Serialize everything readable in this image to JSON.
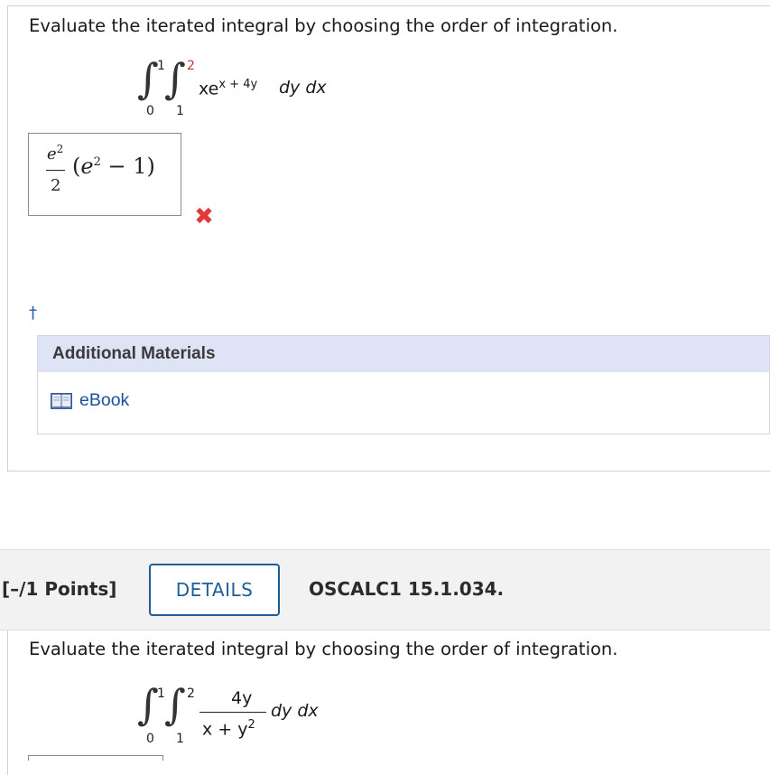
{
  "question1": {
    "prompt": "Evaluate the iterated integral by choosing the order of integration.",
    "outer_lower": "0",
    "outer_upper": "1",
    "inner_lower": "1",
    "inner_upper": "2",
    "integrand_base": "xe",
    "integrand_exponent": "x + 4y",
    "differentials": "dy dx",
    "answer": {
      "numerator_base": "e",
      "numerator_exponent": "2",
      "denominator": "2",
      "paren_base": "e",
      "paren_exponent": "2",
      "paren_rest": "− 1",
      "open_paren": "(",
      "close_paren": ")"
    },
    "status": "incorrect",
    "status_icon": "x-mark-icon",
    "status_symbol": "✖",
    "dagger": "†"
  },
  "additional_materials": {
    "title": "Additional Materials",
    "items": [
      {
        "label": "eBook",
        "icon": "book-icon"
      }
    ]
  },
  "question2": {
    "points": "[–/1 Points]",
    "details_label": "DETAILS",
    "problem_id": "OSCALC1 15.1.034.",
    "prompt": "Evaluate the iterated integral by choosing the order of integration.",
    "outer_lower": "0",
    "outer_upper": "1",
    "inner_lower": "1",
    "inner_upper": "2",
    "numerator": "4y",
    "denominator_base": "x + y",
    "denominator_exponent": "2",
    "differentials": "dy dx"
  },
  "colors": {
    "wrong": "#e03a3a",
    "link": "#1d4f9c",
    "details_border": "#1f5d97",
    "materials_header_bg": "#dfe3f6",
    "red_limit": "#c0392b"
  }
}
